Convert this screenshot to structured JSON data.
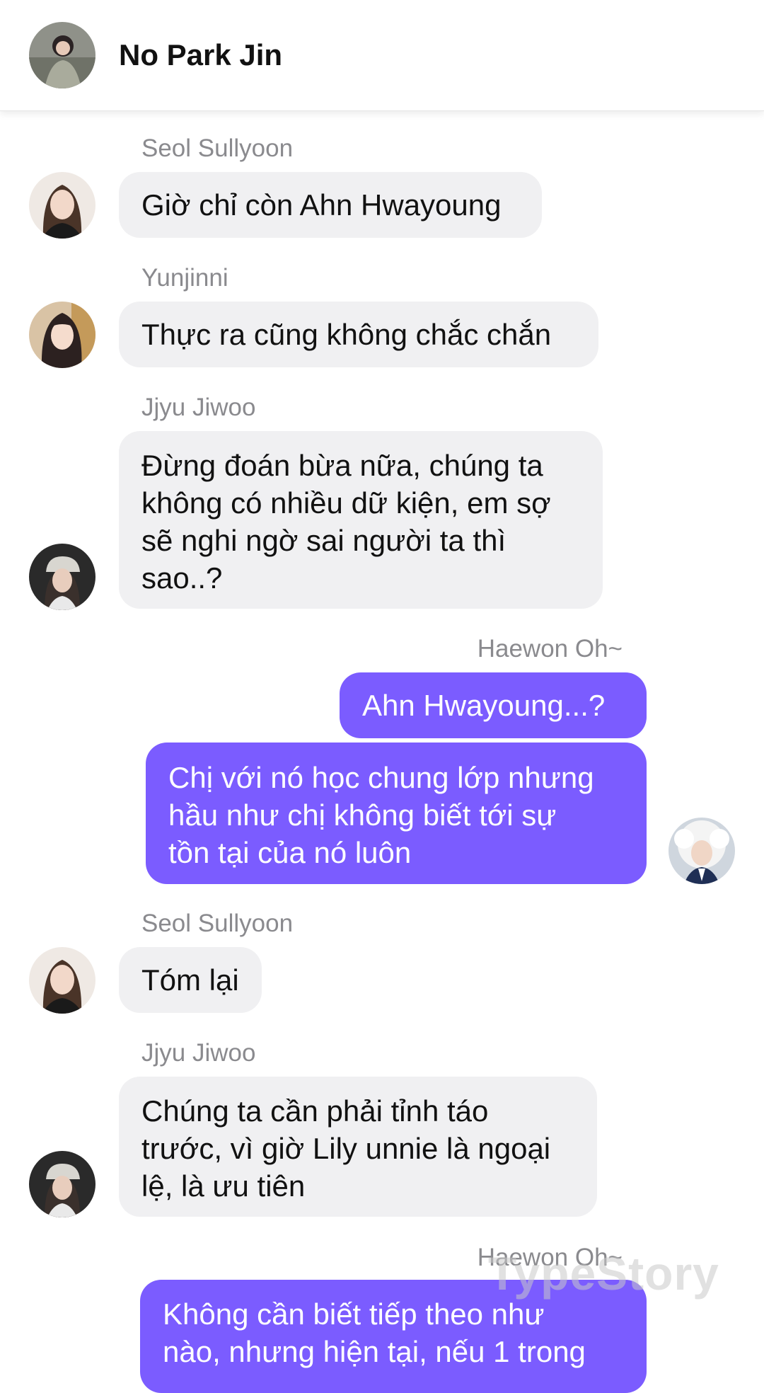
{
  "header": {
    "title": "No Park Jin"
  },
  "colors": {
    "outgoing_bubble": "#7b5cff",
    "incoming_bubble": "#f0f0f2",
    "sender_name": "#8a8a8e"
  },
  "messages": [
    {
      "sender": "Seol Sullyoon",
      "lines": [
        "Giờ chỉ còn Ahn Hwayoung"
      ]
    },
    {
      "sender": "Yunjinni",
      "lines": [
        "Thực ra cũng không chắc chắn"
      ]
    },
    {
      "sender": "Jjyu Jiwoo",
      "lines": [
        "Đừng đoán bừa nữa, chúng ta",
        "không có nhiều dữ kiện, em sợ",
        "sẽ nghi ngờ sai người ta thì",
        "sao..?"
      ]
    },
    {
      "sender": "Haewon Oh~",
      "lines": [
        "Ahn Hwayoung...?"
      ]
    },
    {
      "sender": "",
      "lines": [
        "Chị với nó học chung lớp nhưng",
        "hầu như chị không biết tới sự",
        "tồn tại của nó luôn"
      ]
    },
    {
      "sender": "Seol Sullyoon",
      "lines": [
        "Tóm lại"
      ]
    },
    {
      "sender": "Jjyu Jiwoo",
      "lines": [
        "Chúng ta cần phải tỉnh táo",
        "trước, vì giờ Lily unnie là ngoại",
        "lệ, là ưu tiên"
      ]
    },
    {
      "sender": "Haewon Oh~",
      "lines": [
        "Không cần biết tiếp theo như",
        "nào, nhưng hiện tại, nếu 1 trong"
      ]
    }
  ],
  "watermark": "TypeStory"
}
